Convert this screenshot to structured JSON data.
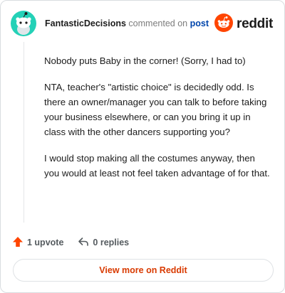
{
  "header": {
    "username": "FantasticDecisions",
    "commented_text": "commented on",
    "post_link": "post",
    "brand": "reddit"
  },
  "comment": {
    "paragraphs": [
      "Nobody puts Baby in the corner! (Sorry, I had to)",
      "NTA, teacher's \"artistic choice\" is decidedly odd. Is there an owner/manager you can talk to before taking your business elsewhere, or can you bring it up in class with the other dancers supporting you?",
      "I would stop making all the costumes anyway, then you would at least not feel taken advantage of for that."
    ]
  },
  "actions": {
    "upvotes": "1 upvote",
    "replies": "0 replies"
  },
  "footer": {
    "view_more": "View more on Reddit"
  },
  "colors": {
    "accent": "#d93a00",
    "reddit_orange": "#ff4500",
    "avatar_teal": "#24d1b7",
    "link_blue": "#0045ac"
  },
  "icons": [
    "reddit-avatar-icon",
    "reddit-logo-icon",
    "upvote-arrow-icon",
    "reply-arrow-icon"
  ]
}
